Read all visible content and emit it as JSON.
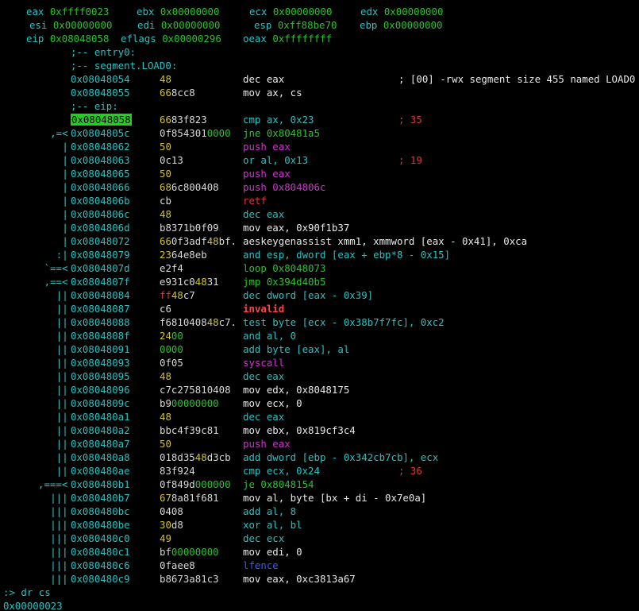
{
  "terminal": {
    "registers": [
      [
        {
          "name": "eax",
          "value": "0xffff0023"
        },
        {
          "name": "ebx",
          "value": "0x00000000"
        },
        {
          "name": "ecx",
          "value": "0x00000000"
        },
        {
          "name": "edx",
          "value": "0x00000000"
        }
      ],
      [
        {
          "name": "esi",
          "value": "0x00000000"
        },
        {
          "name": "edi",
          "value": "0x00000000"
        },
        {
          "name": "esp",
          "value": "0xff88be70"
        },
        {
          "name": "ebp",
          "value": "0x00000000"
        }
      ],
      [
        {
          "name": "eip",
          "value": "0x08048058"
        },
        {
          "name": "eflags",
          "value": "0x00000296"
        },
        {
          "name": "oeax",
          "value": "0xffffffff"
        }
      ]
    ],
    "labels": {
      "entry": ";-- entry0:",
      "segment": ";-- segment.LOAD0:",
      "eip": ";-- eip:"
    },
    "instructions": [
      {
        "arrow": "",
        "addr": "0x08048054",
        "bytes": "48",
        "op": "dec eax",
        "cls": "def",
        "comment": "; [00] -rwx segment size 455 named LOAD0",
        "cmt_color": "#e8e8e8"
      },
      {
        "arrow": "",
        "addr": "0x08048055",
        "bytes": "668cc8",
        "op": "mov ax, cs",
        "cls": "def",
        "comment": ""
      },
      {
        "arrow": "",
        "addr": "0x08048058",
        "bytes": "6683f823",
        "op": "cmp ax, 0x23",
        "cls": "cmp",
        "comment": "; 35",
        "cmt_color": "#e23434",
        "highlight": true
      },
      {
        "arrow": ",=<",
        "addr": "0x0804805c",
        "bytes": "0f8543010000",
        "op": "jne 0x80481a5",
        "cls": "jmp",
        "comment": ""
      },
      {
        "arrow": "|",
        "addr": "0x08048062",
        "bytes": "50",
        "op": "push eax",
        "cls": "push",
        "comment": ""
      },
      {
        "arrow": "|",
        "addr": "0x08048063",
        "bytes": "0c13",
        "op": "or al, 0x13",
        "cls": "cmp",
        "comment": "; 19",
        "cmt_color": "#e23434"
      },
      {
        "arrow": "|",
        "addr": "0x08048065",
        "bytes": "50",
        "op": "push eax",
        "cls": "push",
        "comment": ""
      },
      {
        "arrow": "|",
        "addr": "0x08048066",
        "bytes": "686c800408",
        "op": "push 0x804806c",
        "cls": "push",
        "comment": ""
      },
      {
        "arrow": "|",
        "addr": "0x0804806b",
        "bytes": "cb",
        "op": "retf",
        "cls": "ret",
        "comment": ""
      },
      {
        "arrow": "|",
        "addr": "0x0804806c",
        "bytes": "48",
        "op": "dec eax",
        "cls": "cmp",
        "comment": ""
      },
      {
        "arrow": "|",
        "addr": "0x0804806d",
        "bytes": "b8371b0f09",
        "op": "mov eax, 0x90f1b37",
        "cls": "def",
        "comment": ""
      },
      {
        "arrow": "|",
        "addr": "0x08048072",
        "bytes": "660f3adf48bf.",
        "op": "aeskeygenassist xmm1, xmmword [eax - 0x41], 0xca",
        "cls": "def",
        "comment": ""
      },
      {
        "arrow": ":|",
        "addr": "0x08048079",
        "bytes": "2364e8eb",
        "op": "and esp, dword [eax + ebp*8 - 0x15]",
        "cls": "cmp",
        "comment": ""
      },
      {
        "arrow": "`==<",
        "addr": "0x0804807d",
        "bytes": "e2f4",
        "op": "loop 0x8048073",
        "cls": "jmp",
        "comment": ""
      },
      {
        "arrow": ",==<",
        "addr": "0x0804807f",
        "bytes": "e931c04831",
        "op": "jmp 0x394d40b5",
        "cls": "jmp",
        "comment": ""
      },
      {
        "arrow": "||",
        "addr": "0x08048084",
        "bytes": "ff48c7",
        "op": "dec dword [eax - 0x39]",
        "cls": "cmp",
        "comment": ""
      },
      {
        "arrow": "||",
        "addr": "0x08048087",
        "bytes": "c6",
        "op": "invalid",
        "cls": "inv",
        "comment": ""
      },
      {
        "arrow": "||",
        "addr": "0x08048088",
        "bytes": "f681040848c7.",
        "op": "test byte [ecx - 0x38b7f7fc], 0xc2",
        "cls": "cmp",
        "comment": ""
      },
      {
        "arrow": "||",
        "addr": "0x0804808f",
        "bytes": "2400",
        "op": "and al, 0",
        "cls": "cmp",
        "comment": ""
      },
      {
        "arrow": "||",
        "addr": "0x08048091",
        "bytes": "0000",
        "op": "add byte [eax], al",
        "cls": "cmp",
        "comment": ""
      },
      {
        "arrow": "||",
        "addr": "0x08048093",
        "bytes": "0f05",
        "op": "syscall",
        "cls": "sys",
        "comment": ""
      },
      {
        "arrow": "||",
        "addr": "0x08048095",
        "bytes": "48",
        "op": "dec eax",
        "cls": "cmp",
        "comment": ""
      },
      {
        "arrow": "||",
        "addr": "0x08048096",
        "bytes": "c7c275810408",
        "op": "mov edx, 0x8048175",
        "cls": "def",
        "comment": ""
      },
      {
        "arrow": "||",
        "addr": "0x0804809c",
        "bytes": "b900000000",
        "op": "mov ecx, 0",
        "cls": "def",
        "comment": ""
      },
      {
        "arrow": "||",
        "addr": "0x080480a1",
        "bytes": "48",
        "op": "dec eax",
        "cls": "cmp",
        "comment": ""
      },
      {
        "arrow": "||",
        "addr": "0x080480a2",
        "bytes": "bbc4f39c81",
        "op": "mov ebx, 0x819cf3c4",
        "cls": "def",
        "comment": ""
      },
      {
        "arrow": "||",
        "addr": "0x080480a7",
        "bytes": "50",
        "op": "push eax",
        "cls": "push",
        "comment": ""
      },
      {
        "arrow": "||",
        "addr": "0x080480a8",
        "bytes": "018d3548d3cb",
        "op": "add dword [ebp - 0x342cb7cb], ecx",
        "cls": "cmp",
        "comment": ""
      },
      {
        "arrow": "||",
        "addr": "0x080480ae",
        "bytes": "83f924",
        "op": "cmp ecx, 0x24",
        "cls": "cmp",
        "comment": "; 36",
        "cmt_color": "#e23434"
      },
      {
        "arrow": ",===<",
        "addr": "0x080480b1",
        "bytes": "0f849d000000",
        "op": "je 0x8048154",
        "cls": "jmp",
        "comment": ""
      },
      {
        "arrow": "|||",
        "addr": "0x080480b7",
        "bytes": "678a81f681",
        "op": "mov al, byte [bx + di - 0x7e0a]",
        "cls": "def",
        "comment": ""
      },
      {
        "arrow": "|||",
        "addr": "0x080480bc",
        "bytes": "0408",
        "op": "add al, 8",
        "cls": "cmp",
        "comment": ""
      },
      {
        "arrow": "|||",
        "addr": "0x080480be",
        "bytes": "30d8",
        "op": "xor al, bl",
        "cls": "cmp",
        "comment": ""
      },
      {
        "arrow": "|||",
        "addr": "0x080480c0",
        "bytes": "49",
        "op": "dec ecx",
        "cls": "cmp",
        "comment": ""
      },
      {
        "arrow": "|||",
        "addr": "0x080480c1",
        "bytes": "bf00000000",
        "op": "mov edi, 0",
        "cls": "def",
        "comment": ""
      },
      {
        "arrow": "|||",
        "addr": "0x080480c6",
        "bytes": "0faee8",
        "op": "lfence",
        "cls": "lf",
        "comment": ""
      },
      {
        "arrow": "|||",
        "addr": "0x080480c9",
        "bytes": "b8673a81c3",
        "op": "mov eax, 0xc3813a67",
        "cls": "def",
        "comment": ""
      }
    ],
    "prompt": ":> dr cs",
    "output": "0x00000023"
  }
}
